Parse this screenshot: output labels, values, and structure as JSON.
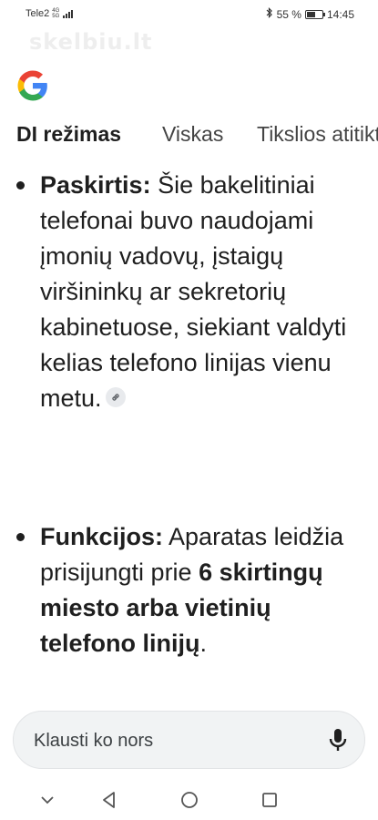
{
  "status_bar": {
    "carrier": "Tele2",
    "network_type_top": "4G",
    "network_type_bottom": "5G",
    "battery_percent": "55 %",
    "battery_level": 0.55,
    "time": "14:45"
  },
  "watermark": "skelbiu.lt",
  "tabs": [
    {
      "label": "DI režimas",
      "active": true
    },
    {
      "label": "Viskas",
      "active": false
    },
    {
      "label": "Tikslios atitiktys",
      "active": false
    }
  ],
  "content": {
    "items": [
      {
        "heading": "Paskirtis:",
        "text": " Šie bakelitiniai telefonai buvo naudojami įmonių vadovų, įstaigų viršininkų ar sekretorių kabinetuose, siekiant valdyti kelias telefono linijas vienu metu."
      },
      {
        "heading": "Funkcijos:",
        "text_before": " Aparatas leidžia prisijungti prie ",
        "text_bold": "6 skirtingų miesto arba vietinių telefono linijų",
        "text_after": "."
      }
    ]
  },
  "ask_bar": {
    "placeholder": "Klausti ko nors"
  },
  "icons": {
    "logo": "google-logo",
    "link": "link-icon",
    "mic": "microphone-icon",
    "nav_down": "chevron-down-icon",
    "nav_back": "back-triangle-icon",
    "nav_home": "home-circle-icon",
    "nav_recent": "recent-square-icon"
  }
}
